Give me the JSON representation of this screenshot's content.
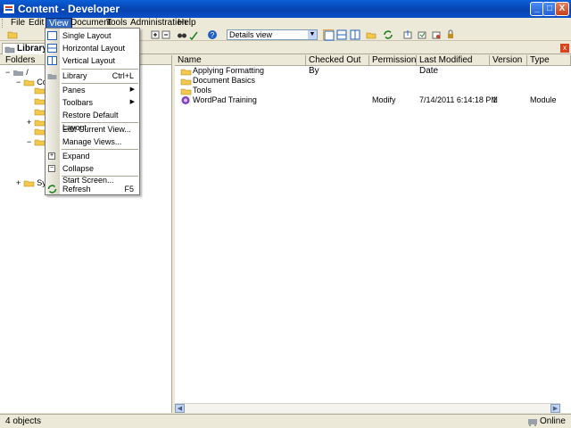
{
  "window": {
    "title": "Content - Developer",
    "minimize_label": "_",
    "maximize_label": "□",
    "close_label": "X"
  },
  "menubar": {
    "items": [
      "File",
      "Edit",
      "View",
      "Document",
      "Tools",
      "Administration",
      "Help"
    ]
  },
  "toolbar": {
    "view_select_value": "Details view",
    "view_select_arrow": "▼"
  },
  "tab": {
    "label": "Library",
    "close_label": "x"
  },
  "left_pane": {
    "header": "Folders",
    "root_label": "/",
    "child_1_label": "Con",
    "child_2_label": "Sys",
    "expander_open": "−",
    "expander_closed": "+"
  },
  "right_pane": {
    "columns": [
      "Name",
      "Checked Out By",
      "Permission",
      "Last Modified Date",
      "Version",
      "Type"
    ],
    "rows": [
      {
        "name": "Applying Formatting",
        "checked_out_by": "",
        "permission": "",
        "modified": "",
        "version": "",
        "type": ""
      },
      {
        "name": "Document Basics",
        "checked_out_by": "",
        "permission": "",
        "modified": "",
        "version": "",
        "type": ""
      },
      {
        "name": "Tools",
        "checked_out_by": "",
        "permission": "",
        "modified": "",
        "version": "",
        "type": ""
      },
      {
        "name": "WordPad Training",
        "checked_out_by": "",
        "permission": "Modify",
        "modified": "7/14/2011 6:14:18 PM",
        "version": "1",
        "type": "Module"
      }
    ]
  },
  "scrollbar": {
    "left_arrow": "◀",
    "right_arrow": "▶"
  },
  "view_menu": {
    "items": [
      {
        "label": "Single Layout",
        "shortcut": ""
      },
      {
        "label": "Horizontal Layout",
        "shortcut": ""
      },
      {
        "label": "Vertical Layout",
        "shortcut": ""
      },
      {
        "label": "Library",
        "shortcut": "Ctrl+L"
      },
      {
        "label": "Panes",
        "shortcut": ""
      },
      {
        "label": "Toolbars",
        "shortcut": ""
      },
      {
        "label": "Restore Default Layout",
        "shortcut": ""
      },
      {
        "label": "Edit Current View...",
        "shortcut": ""
      },
      {
        "label": "Manage Views...",
        "shortcut": ""
      },
      {
        "label": "Expand",
        "shortcut": ""
      },
      {
        "label": "Collapse",
        "shortcut": ""
      },
      {
        "label": "Start Screen...",
        "shortcut": ""
      },
      {
        "label": "Refresh",
        "shortcut": "F5"
      }
    ],
    "submenu_arrow": "▶",
    "expand_glyph": "+",
    "collapse_glyph": "−"
  },
  "statusbar": {
    "count": "4 objects",
    "connection": "Online"
  },
  "colors": {
    "accent": "#316ac5",
    "folder": "#f2c94c",
    "title_bar": "#0842b0"
  }
}
